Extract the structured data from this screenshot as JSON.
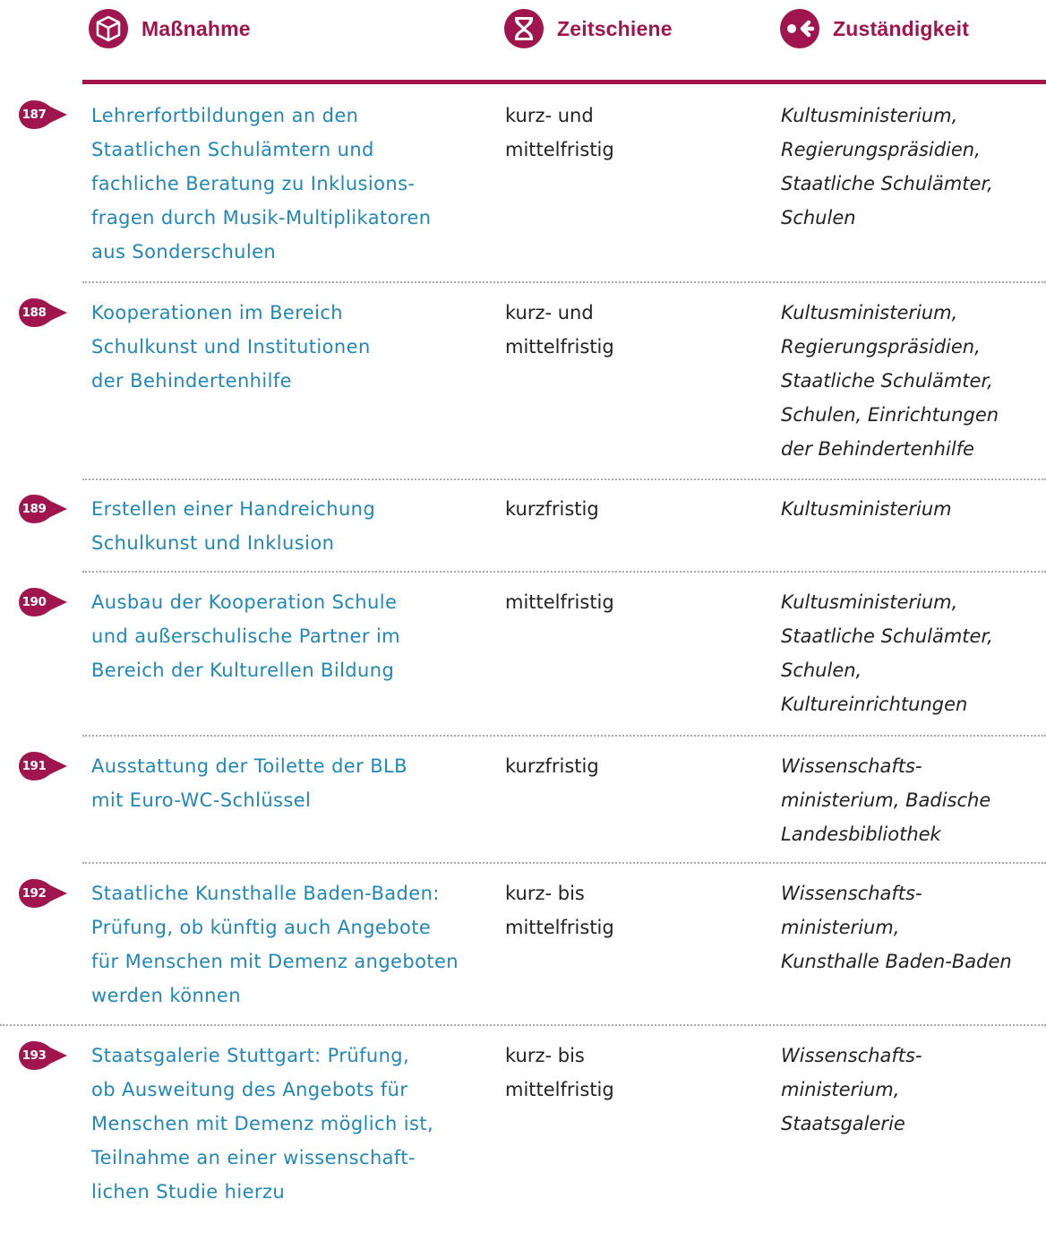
{
  "header": {
    "measure_label": "Maßnahme",
    "time_label": "Zeitschiene",
    "resp_label": "Zuständigkeit",
    "accent_color": "#A1154F"
  },
  "icons": {
    "measure": "cube-icon",
    "time": "hourglass-icon",
    "responsibility": "arrow-back-dot-icon"
  },
  "rows": [
    {
      "number": "187",
      "measure": "Lehrerfortbildungen an den\nStaatlichen Schulämtern und\nfachliche Beratung zu Inklusions-\nfragen durch Musik-Multiplikatoren\naus Sonderschulen",
      "time": "kurz- und\nmittelfristig",
      "responsibility": "Kultusministerium,\nRegierungspräsidien,\nStaatliche Schulämter,\nSchulen"
    },
    {
      "number": "188",
      "measure": "Kooperationen im Bereich\nSchulkunst und Institutionen\nder Behindertenhilfe",
      "time": "kurz- und\nmittelfristig",
      "responsibility": "Kultusministerium,\nRegierungspräsidien,\nStaatliche Schulämter,\nSchulen, Einrichtungen\nder Behindertenhilfe"
    },
    {
      "number": "189",
      "measure": "Erstellen einer Handreichung\nSchulkunst und Inklusion",
      "time": "kurzfristig",
      "responsibility": "Kultusministerium"
    },
    {
      "number": "190",
      "measure": "Ausbau der Kooperation Schule\nund außerschulische Partner im\nBereich der Kulturellen Bildung",
      "time": "mittelfristig",
      "responsibility": "Kultusministerium,\nStaatliche Schulämter,\nSchulen,\nKultureinrichtungen"
    },
    {
      "number": "191",
      "measure": "Ausstattung der Toilette der BLB\nmit Euro-WC-Schlüssel",
      "time": "kurzfristig",
      "responsibility": "Wissenschafts-\nministerium, Badische\nLandesbibliothek"
    },
    {
      "number": "192",
      "measure": "Staatliche Kunsthalle Baden-Baden:\nPrüfung, ob künftig auch Angebote\nfür Menschen mit Demenz angeboten\nwerden können",
      "time": "kurz- bis\nmittelfristig",
      "responsibility": "Wissenschafts-\nministerium,\nKunsthalle Baden-Baden"
    },
    {
      "number": "193",
      "measure": "Staatsgalerie Stuttgart: Prüfung,\nob Ausweitung des Angebots für\nMenschen mit Demenz möglich ist,\nTeilnahme an einer wissenschaft-\nlichen Studie hierzu",
      "time": "kurz- bis\nmittelfristig",
      "responsibility": "Wissenschafts-\nministerium,\nStaatsgalerie"
    }
  ]
}
